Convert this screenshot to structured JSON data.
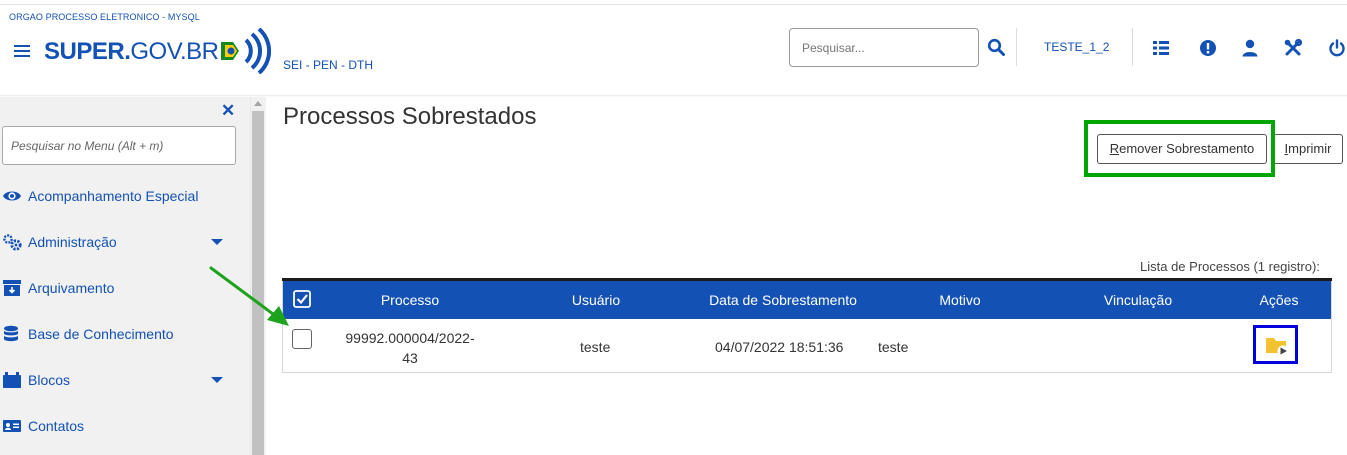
{
  "header": {
    "org_name": "ORGAO PROCESSO ELETRONICO - MYSQL",
    "logo_text_bold": "SUPER.",
    "logo_text_light": "GOV.BR",
    "environment": "SEI - PEN - DTH",
    "search_placeholder": "Pesquisar...",
    "unit": "TESTE_1_2",
    "icons": [
      "hamburger-menu-icon",
      "search-icon",
      "grid-list-icon",
      "exclamation-alert-icon",
      "user-icon",
      "tools-icon",
      "power-icon"
    ]
  },
  "sidebar": {
    "search_placeholder": "Pesquisar no Menu (Alt + m)",
    "close_label": "✕",
    "items": [
      {
        "label": "Acompanhamento Especial",
        "icon": "eye-icon",
        "has_submenu": false
      },
      {
        "label": "Administração",
        "icon": "gears-icon",
        "has_submenu": true
      },
      {
        "label": "Arquivamento",
        "icon": "archive-box-icon",
        "has_submenu": false
      },
      {
        "label": "Base de Conhecimento",
        "icon": "database-icon",
        "has_submenu": false
      },
      {
        "label": "Blocos",
        "icon": "blocks-icon",
        "has_submenu": true
      },
      {
        "label": "Contatos",
        "icon": "contact-card-icon",
        "has_submenu": false
      }
    ]
  },
  "main": {
    "title": "Processos Sobrestados",
    "buttons": {
      "remove_first": "R",
      "remove_rest": "emover Sobrestamento",
      "print_first": "I",
      "print_rest": "mprimir"
    },
    "list_caption": "Lista de Processos (1 registro):",
    "table": {
      "headers": [
        "Processo",
        "Usuário",
        "Data de Sobrestamento",
        "Motivo",
        "Vinculação",
        "Ações"
      ],
      "rows": [
        {
          "processo_line1": "99992.000004/2022-",
          "processo_line2": "43",
          "usuario": "teste",
          "data": "04/07/2022 18:51:36",
          "motivo": "teste",
          "vinculacao": "",
          "acao_icon": "folder-play-icon"
        }
      ]
    }
  },
  "colors": {
    "primary": "#1351b4",
    "highlight_green": "#00a600",
    "highlight_blue": "#0000dd",
    "arrow_green": "#1ea31e",
    "folder_yellow": "#f2c230"
  }
}
